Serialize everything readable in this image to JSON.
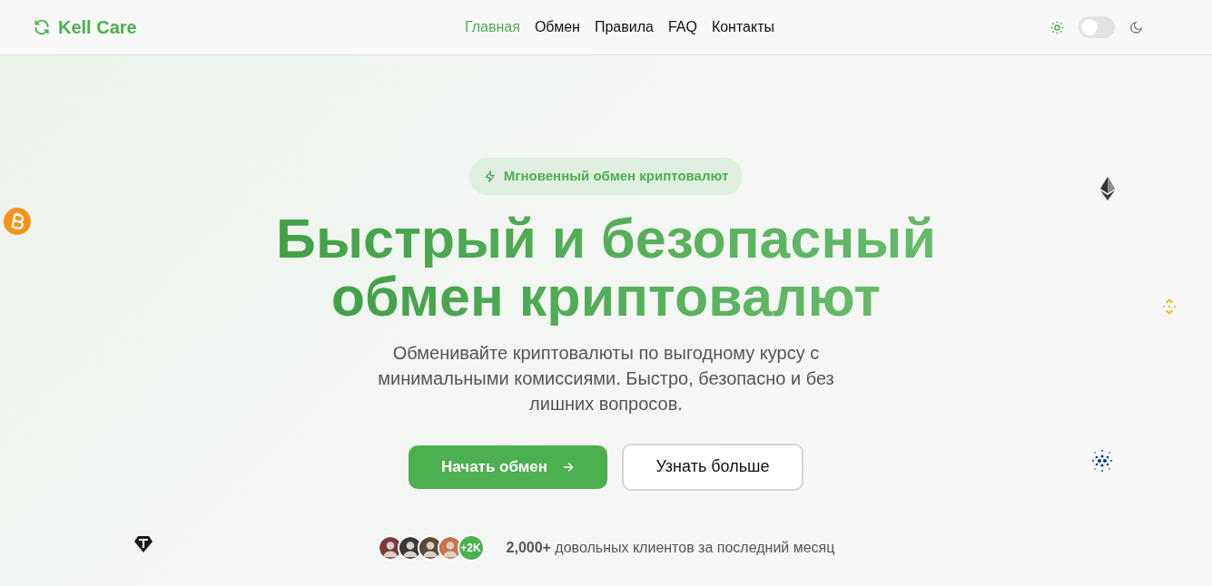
{
  "brand": "Kell Care",
  "nav": [
    {
      "label": "Главная",
      "selected": true
    },
    {
      "label": "Обмен",
      "selected": false
    },
    {
      "label": "Правила",
      "selected": false
    },
    {
      "label": "FAQ",
      "selected": false
    },
    {
      "label": "Контакты",
      "selected": false
    }
  ],
  "theme_toggle": {
    "dark": false
  },
  "hero": {
    "badge": "Мгновенный обмен криптовалют",
    "title_lines": [
      "Быстрый и безопасный",
      "обмен криптовалют"
    ],
    "subtitle": "Обменивайте криптовалюты по выгодному курсу с минимальными комиссиями. Быстро, безопасно и без лишних вопросов.",
    "buttons": [
      {
        "label": "Начать обмен",
        "kind": "primary"
      },
      {
        "label": "Узнать больше",
        "kind": "outline"
      }
    ],
    "avatars": [
      {
        "color": "#7a3a3a"
      },
      {
        "color": "#3a3a3a"
      },
      {
        "color": "#5a4a3a"
      },
      {
        "color": "#c8734a"
      }
    ],
    "avatar_more": "+2K",
    "proof": "**2,000+** довольных клиентов за последний месяц"
  },
  "coins": [
    {
      "kind": "bitcoin"
    },
    {
      "kind": "ethereum"
    },
    {
      "kind": "binance"
    },
    {
      "kind": "cardano"
    },
    {
      "kind": "tether"
    }
  ]
}
